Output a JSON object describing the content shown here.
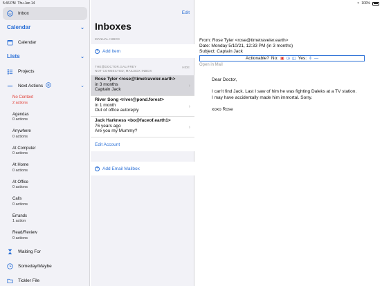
{
  "status": {
    "time": "5:46 PM",
    "date": "Thu Jan 14",
    "battery": "100%"
  },
  "sidebar": {
    "inbox_label": "Inbox",
    "calendar_section": "Calendar",
    "calendar_item": "Calendar",
    "lists_section": "Lists",
    "projects": "Projects",
    "next_actions": "Next Actions",
    "contexts": [
      {
        "name": "No Context",
        "count": "2 actions"
      },
      {
        "name": "Agendas",
        "count": "0 actions"
      },
      {
        "name": "Anywhere",
        "count": "0 actions"
      },
      {
        "name": "At Computer",
        "count": "0 actions"
      },
      {
        "name": "At Home",
        "count": "0 actions"
      },
      {
        "name": "At Office",
        "count": "0 actions"
      },
      {
        "name": "Calls",
        "count": "0 actions"
      },
      {
        "name": "Errands",
        "count": "1 action"
      },
      {
        "name": "Read/Review",
        "count": "0 actions"
      }
    ],
    "waiting_for": "Waiting For",
    "someday": "Someday/Maybe",
    "tickler": "Tickler File"
  },
  "middle": {
    "edit": "Edit",
    "title": "Inboxes",
    "manual_header": "MANUAL INBOX",
    "add_item": "Add Item",
    "mailbox_header_1": "THE@DOCTOR.GALIFREY",
    "mailbox_header_2": "NOT CONNECTED; MAILBOX INBOX",
    "hide": "HIDE",
    "messages": [
      {
        "from": "Rose Tyler <rose@timetraveler.earth>",
        "when": "in 3 months",
        "subject": "Captain Jack"
      },
      {
        "from": "River Song <river@pond.forest>",
        "when": "in 1 month",
        "subject": "Out of office autoreply"
      },
      {
        "from": "Jack Harkness <bo@faceof.earth1>",
        "when": "76 years ago",
        "subject": "Are you my Mummy?"
      }
    ],
    "edit_account": "Edit Account",
    "add_mailbox": "Add Email Mailbox"
  },
  "detail": {
    "from": "From: Rose Tyler <rose@timetraveler.earth>",
    "date": "Date: Monday 5/10/21, 12:33 PM (in 3 months)",
    "subject": "Subject: Captain Jack",
    "actionable": "Actionable?",
    "no": "No:",
    "yes": "Yes:",
    "open_in_mail": "Open in Mail",
    "greeting": "Dear Doctor,",
    "line1": "I can't find Jack. Last I saw of him he was fighting Daleks at a TV station.",
    "line2": "I may have accidentally made him immortal. Sorry.",
    "signoff": "xoxo Rose"
  }
}
